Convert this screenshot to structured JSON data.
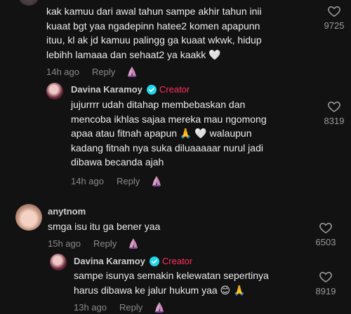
{
  "colors": {
    "background": "#121212",
    "creator_accent": "#ff2f5e",
    "verified": "#20d5ec"
  },
  "icons": {
    "heart": "heart-outline-icon",
    "react": "prayer-hands-emoji-icon",
    "verified": "verified-badge-icon"
  },
  "comments": [
    {
      "text_lines": [
        "kak kamuu dari awal tahun sampe akhir tahun inii",
        "kuaat bgt yaa ngadepinn hatee2 komen apapunn",
        "ituu, kl ak jd kamuu palingg ga kuaat wkwk, hidup",
        "lebihh lamaaa dan sehaat2 ya kaakk 🤍"
      ],
      "time": "14h ago",
      "reply": "Reply",
      "likes": "9725",
      "replies": [
        {
          "username": "Davina Karamoy",
          "creator_label": "Creator",
          "text_lines": [
            "jujurrrr udah ditahap membebaskan dan",
            "mencoba ikhlas sajaa mereka mau ngomong",
            "apaa atau fitnah apapun 🙏 🤍  walaupun",
            "kadang fitnah nya suka diluaaaaar nurul jadi",
            "dibawa becanda ajah"
          ],
          "time": "14h ago",
          "reply": "Reply",
          "likes": "8319"
        }
      ]
    },
    {
      "username": "anytnom",
      "text_lines": [
        "smga isu itu ga bener yaa"
      ],
      "time": "15h ago",
      "reply": "Reply",
      "likes": "6503",
      "replies": [
        {
          "username": "Davina Karamoy",
          "creator_label": "Creator",
          "text_lines": [
            "sampe isunya semakin kelewatan sepertinya",
            "harus dibawa ke jalur hukum yaa 😊 🙏"
          ],
          "time": "13h ago",
          "reply": "Reply",
          "likes": "8919"
        }
      ]
    }
  ]
}
